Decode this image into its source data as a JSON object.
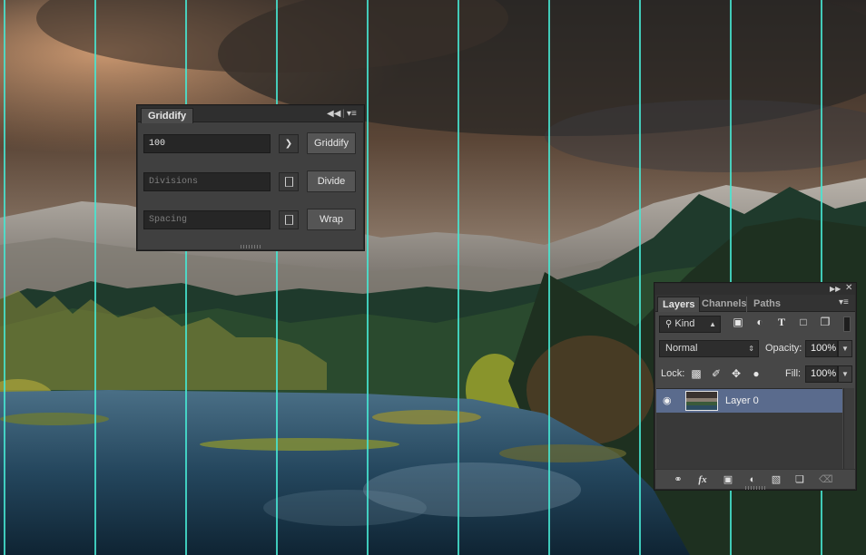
{
  "colors": {
    "guide": "#46e6d2",
    "panel_bg": "#404040",
    "layer_selected": "#5a6b8d"
  },
  "guides": {
    "count": 10
  },
  "griddify": {
    "tab_label": "Griddify",
    "collapse_icon": "double-chevron-left-icon",
    "menu_icon": "panel-menu-icon",
    "value": "100",
    "arrow_icon": "play-arrow-icon",
    "griddify_label": "Griddify",
    "divisions_placeholder": "Divisions",
    "divide_label": "Divide",
    "spacing_placeholder": "Spacing",
    "wrap_label": "Wrap"
  },
  "layers": {
    "tabs": [
      "Layers",
      "Channels",
      "Paths"
    ],
    "filter": {
      "value": "Kind",
      "icons": [
        "image-filter-icon",
        "adjustment-filter-icon",
        "type-filter-icon",
        "shape-filter-icon",
        "smart-object-filter-icon"
      ]
    },
    "blend_mode": "Normal",
    "opacity_label": "Opacity:",
    "opacity_value": "100%",
    "lock_label": "Lock:",
    "fill_label": "Fill:",
    "fill_value": "100%",
    "items": [
      {
        "name": "Layer 0",
        "visible": true
      }
    ],
    "bottom_icons": [
      "link-icon",
      "fx-icon",
      "mask-icon",
      "adjustment-layer-icon",
      "group-folder-icon",
      "new-layer-icon",
      "trash-icon"
    ]
  }
}
